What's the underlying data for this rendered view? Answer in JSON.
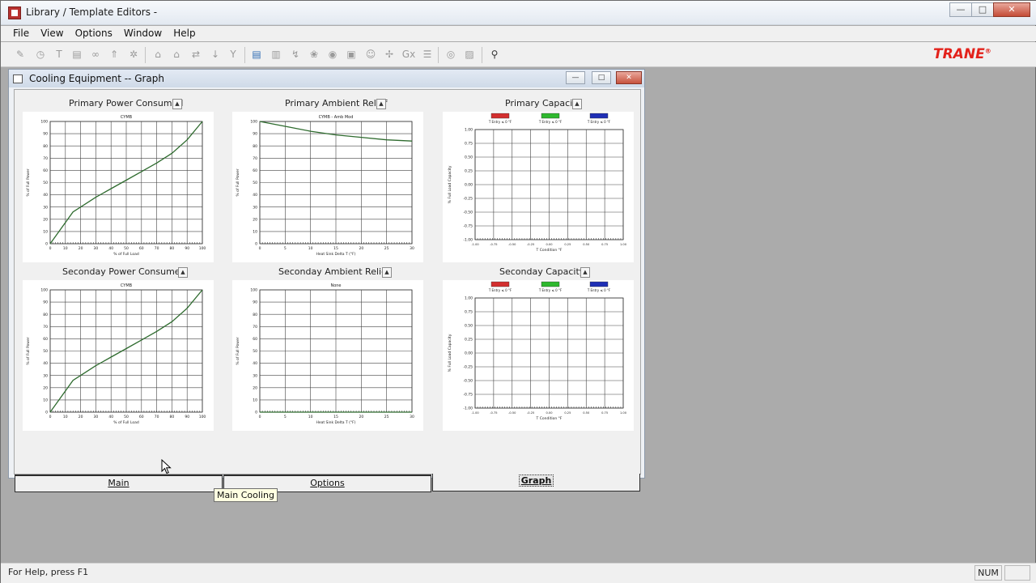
{
  "app": {
    "title": "Library / Template Editors -",
    "brand": "TRANE",
    "brand_mark": "®"
  },
  "window_buttons": {
    "minimize": "—",
    "maximize": "□",
    "close": "✕"
  },
  "menu": [
    "File",
    "View",
    "Options",
    "Window",
    "Help"
  ],
  "toolbar_icons": [
    "pin-icon",
    "clock-icon",
    "filter-icon",
    "clipboard-icon",
    "link-icon",
    "up-arrow-icon",
    "gear-icon",
    "house-icon",
    "home-outline-icon",
    "swap-icon",
    "download-icon",
    "funnel-icon",
    "list-blue-icon",
    "document-icon",
    "wand-icon",
    "leaf-icon",
    "eye-icon",
    "window-icon",
    "cat-icon",
    "fan-icon",
    "image-icon",
    "gx-icon",
    "stack-icon",
    "globe-icon",
    "chart-icon",
    "help-pointer-icon"
  ],
  "child": {
    "title": "Cooling Equipment -- Graph",
    "buttons": {
      "minimize": "—",
      "maximize": "□",
      "close": "✕"
    }
  },
  "dropdown_arrow": "▲",
  "graphs": {
    "primary_power": {
      "title": "Primary Power Consumed",
      "subtitle": "CYMB",
      "xlabel": "% of Full Load",
      "ylabel": "% of Full Power"
    },
    "primary_ambient": {
      "title": "Primary Ambient Relief",
      "subtitle": "CYMB - Amb Mod",
      "xlabel": "Heat Sink Delta T (°F)",
      "ylabel": "% of Full Power"
    },
    "primary_capacity": {
      "title": "Primary Capacity",
      "xlabel": "T Condition °F",
      "ylabel": "% Full Load Capacity"
    },
    "secondary_power": {
      "title": "Seconday Power Consumed",
      "subtitle": "CYMB",
      "xlabel": "% of Full Load",
      "ylabel": "% of Full Power"
    },
    "secondary_ambient": {
      "title": "Seconday Ambient Relief",
      "subtitle": "None",
      "xlabel": "Heat Sink Delta T (°F)",
      "ylabel": "% of Full Power"
    },
    "secondary_capacity": {
      "title": "Seconday Capacity",
      "xlabel": "T Condition °F",
      "ylabel": "% Full Load Capacity"
    }
  },
  "capacity_legend": [
    {
      "label": "T Entry ≤ 0 °F",
      "color": "#d32f2f"
    },
    {
      "label": "T Entry ≤ 0 °F",
      "color": "#2eb82e"
    },
    {
      "label": "T Entry ≤ 0 °F",
      "color": "#1f2fb5"
    }
  ],
  "series_color": "#2e6b2e",
  "chart_data": [
    {
      "type": "line",
      "title": "Primary Power Consumed",
      "subtitle": "CYMB",
      "xlabel": "% of Full Load",
      "ylabel": "% of Full Power",
      "xlim": [
        0,
        100
      ],
      "ylim": [
        0,
        100
      ],
      "xticks": [
        0,
        10,
        20,
        30,
        40,
        50,
        60,
        70,
        80,
        90,
        100
      ],
      "yticks": [
        0,
        10,
        20,
        30,
        40,
        50,
        60,
        70,
        80,
        90,
        100
      ],
      "grid": true,
      "x": [
        0,
        15,
        20,
        30,
        40,
        50,
        60,
        70,
        80,
        90,
        100
      ],
      "y": [
        0,
        26,
        30,
        38,
        45,
        52,
        59,
        66,
        74,
        85,
        100
      ]
    },
    {
      "type": "line",
      "title": "Primary Ambient Relief",
      "subtitle": "CYMB - Amb Mod",
      "xlabel": "Heat Sink Delta T (°F)",
      "ylabel": "% of Full Power",
      "xlim": [
        0,
        30
      ],
      "ylim": [
        0,
        100
      ],
      "xticks": [
        0,
        5,
        10,
        15,
        20,
        25,
        30
      ],
      "yticks": [
        0,
        10,
        20,
        30,
        40,
        50,
        60,
        70,
        80,
        90,
        100
      ],
      "grid": true,
      "x": [
        0,
        5,
        10,
        15,
        20,
        25,
        30
      ],
      "y": [
        100,
        96,
        92,
        89,
        87,
        85,
        84
      ]
    },
    {
      "type": "line",
      "title": "Primary Capacity",
      "xlabel": "T Condition °F",
      "ylabel": "% Full Load Capacity",
      "xlim": [
        -1.0,
        1.0
      ],
      "ylim": [
        -1.0,
        1.0
      ],
      "xticks": [
        -1.0,
        -0.75,
        -0.5,
        -0.25,
        0,
        0.25,
        0.5,
        0.75,
        1.0
      ],
      "xtick_labels": [
        "-1.00",
        "-0.75",
        "-0.50",
        "-0.25",
        "0.00",
        "0.25",
        "0.50",
        "0.75",
        "1.00"
      ],
      "yticks": [
        -1.0,
        -0.75,
        -0.5,
        -0.25,
        0,
        0.25,
        0.5,
        0.75,
        1.0
      ],
      "ytick_labels": [
        "-1.00",
        "-0.75",
        "-0.50",
        "-0.25",
        "0.00",
        "0.25",
        "0.50",
        "0.75",
        "1.00"
      ],
      "grid": true,
      "series": [
        {
          "name": "T Entry ≤ 0 °F",
          "values": []
        },
        {
          "name": "T Entry ≤ 0 °F",
          "values": []
        },
        {
          "name": "T Entry ≤ 0 °F",
          "values": []
        }
      ]
    },
    {
      "type": "line",
      "title": "Seconday Power Consumed",
      "subtitle": "CYMB",
      "xlabel": "% of Full Load",
      "ylabel": "% of Full Power",
      "xlim": [
        0,
        100
      ],
      "ylim": [
        0,
        100
      ],
      "xticks": [
        0,
        10,
        20,
        30,
        40,
        50,
        60,
        70,
        80,
        90,
        100
      ],
      "yticks": [
        0,
        10,
        20,
        30,
        40,
        50,
        60,
        70,
        80,
        90,
        100
      ],
      "grid": true,
      "x": [
        0,
        15,
        20,
        30,
        40,
        50,
        60,
        70,
        80,
        90,
        100
      ],
      "y": [
        0,
        26,
        30,
        38,
        45,
        52,
        59,
        66,
        74,
        85,
        100
      ]
    },
    {
      "type": "line",
      "title": "Seconday Ambient Relief",
      "subtitle": "None",
      "xlabel": "Heat Sink Delta T (°F)",
      "ylabel": "% of Full Power",
      "xlim": [
        0,
        30
      ],
      "ylim": [
        0,
        100
      ],
      "xticks": [
        0,
        5,
        10,
        15,
        20,
        25,
        30
      ],
      "yticks": [
        0,
        10,
        20,
        30,
        40,
        50,
        60,
        70,
        80,
        90,
        100
      ],
      "grid": true,
      "x": [
        0,
        30
      ],
      "y": [
        0,
        0
      ]
    },
    {
      "type": "line",
      "title": "Seconday Capacity",
      "xlabel": "T Condition °F",
      "ylabel": "% Full Load Capacity",
      "xlim": [
        -1.0,
        1.0
      ],
      "ylim": [
        -1.0,
        1.0
      ],
      "xticks": [
        -1.0,
        -0.75,
        -0.5,
        -0.25,
        0,
        0.25,
        0.5,
        0.75,
        1.0
      ],
      "xtick_labels": [
        "-1.00",
        "-0.75",
        "-0.50",
        "-0.25",
        "0.00",
        "0.25",
        "0.50",
        "0.75",
        "1.00"
      ],
      "yticks": [
        -1.0,
        -0.75,
        -0.5,
        -0.25,
        0,
        0.25,
        0.5,
        0.75,
        1.0
      ],
      "ytick_labels": [
        "-1.00",
        "-0.75",
        "-0.50",
        "-0.25",
        "0.00",
        "0.25",
        "0.50",
        "0.75",
        "1.00"
      ],
      "grid": true,
      "series": [
        {
          "name": "T Entry ≤ 0 °F",
          "values": []
        },
        {
          "name": "T Entry ≤ 0 °F",
          "values": []
        },
        {
          "name": "T Entry ≤ 0 °F",
          "values": []
        }
      ]
    }
  ],
  "tabs": [
    {
      "label": "Main",
      "active": false
    },
    {
      "label": "Options",
      "active": false
    },
    {
      "label": "Graph",
      "active": true
    }
  ],
  "tooltip": "Main Cooling",
  "status": {
    "text": "For Help, press F1",
    "num": "NUM"
  }
}
